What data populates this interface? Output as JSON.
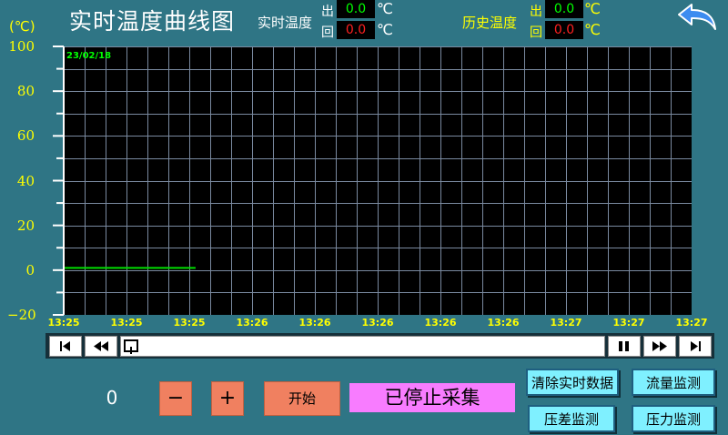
{
  "header": {
    "title": "实时温度曲线图",
    "realtime": {
      "label": "实时温度",
      "out_label": "出",
      "out_value": "0.0",
      "back_label": "回",
      "back_value": "0.0",
      "unit": "℃"
    },
    "history": {
      "label": "历史温度",
      "out_label": "出",
      "out_value": "0.0",
      "back_label": "回",
      "back_value": "0.0",
      "unit": "℃"
    },
    "back_icon": "return-arrow-icon"
  },
  "chart_data": {
    "type": "line",
    "unit_label": "(℃)",
    "date": "23/02/18",
    "ylim": [
      -20,
      100
    ],
    "yticks": [
      "100",
      "80",
      "60",
      "40",
      "20",
      "0",
      "−20"
    ],
    "xticks": [
      "13:25",
      "13:25",
      "13:25",
      "13:26",
      "13:26",
      "13:26",
      "13:26",
      "13:26",
      "13:27",
      "13:27",
      "13:27"
    ],
    "grid": true,
    "series": [
      {
        "x_start_index": 0,
        "x_end_index": 2.1,
        "values": [
          1,
          1
        ],
        "color": "#00dd00"
      }
    ]
  },
  "nav": {
    "first_icon": "skip-to-start-icon",
    "rewind_icon": "rewind-icon",
    "pause_icon": "pause-icon",
    "forward_icon": "fast-forward-icon",
    "last_icon": "skip-to-end-icon"
  },
  "controls": {
    "counter": "0",
    "minus": "−",
    "plus": "+",
    "start": "开始",
    "status": "已停止采集"
  },
  "buttons": {
    "clear": "清除实时数据",
    "flow": "流量监测",
    "pressure_diff": "压差监测",
    "pressure": "压力监测"
  },
  "colors": {
    "background": "#2f7585",
    "accent_yellow": "#ffff00",
    "value_green": "#00ff00",
    "value_red": "#ff2020"
  }
}
